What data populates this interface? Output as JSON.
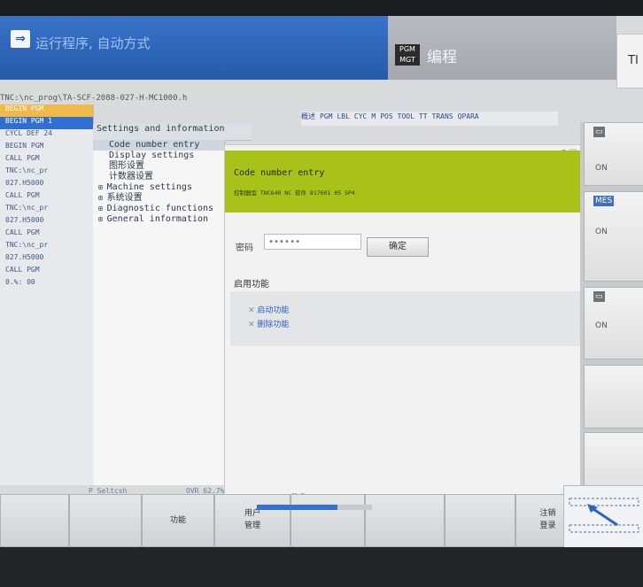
{
  "header": {
    "mode_text": "运行程序, 自动方式",
    "mode_icon": "⇒",
    "prog_icon": "PGM MGT",
    "prog_text": "编程",
    "right_top": "TI"
  },
  "program_list": {
    "path": "TNC:\\nc_prog\\TA-SCF-2088-027-H-MC1000.h",
    "rows": [
      "BEGIN PGM",
      "BEGIN PGM 1",
      "CYCL DEF 24",
      "BEGIN PGM",
      "CALL PGM",
      "TNC:\\nc_pr",
      "027.H5000",
      "CALL PGM",
      "TNC:\\nc_pr",
      "027.H5000",
      "CALL PGM",
      "TNC:\\nc_pr",
      "027.H5000",
      "CALL PGM",
      "0.%: 00"
    ]
  },
  "settings": {
    "header": "Settings and information",
    "items": [
      {
        "label": "Code number entry",
        "plus": false,
        "selected": true
      },
      {
        "label": "Display settings",
        "plus": false
      },
      {
        "label": "图形设置",
        "plus": false
      },
      {
        "label": "计数器设置",
        "plus": false
      },
      {
        "label": "Machine settings",
        "plus": true
      },
      {
        "label": "系统设置",
        "plus": true
      },
      {
        "label": "Diagnostic functions",
        "plus": true
      },
      {
        "label": "General information",
        "plus": true
      }
    ]
  },
  "tabs": [
    "概述",
    "PGM",
    "LBL",
    "CYC",
    "M",
    "POS",
    "TOOL",
    "TT",
    "TRANS",
    "QPARA"
  ],
  "dialog": {
    "controls": "? ☐",
    "title": "Code number entry",
    "info": "控制器型   TNC640     NC 软件   817601 05 SP4",
    "password_label": "密码",
    "password_value": "••••••",
    "ok_label": "确定",
    "func_title": "启用功能",
    "func_items": [
      "启动功能",
      "删除功能"
    ]
  },
  "right_panel": {
    "btn1": {
      "label": "▭",
      "sub": "ON"
    },
    "meas": {
      "label": "MES",
      "sub": "ON"
    },
    "btn3": {
      "label": "▭",
      "sub": "ON"
    }
  },
  "status": {
    "left": "P Seltcsh",
    "mid": "OVR 62.7%",
    "right": "M 5",
    "progress": 0.7
  },
  "softkeys": [
    "",
    "",
    "功能",
    "用户 管理",
    "",
    "",
    "",
    "注销 登录"
  ]
}
